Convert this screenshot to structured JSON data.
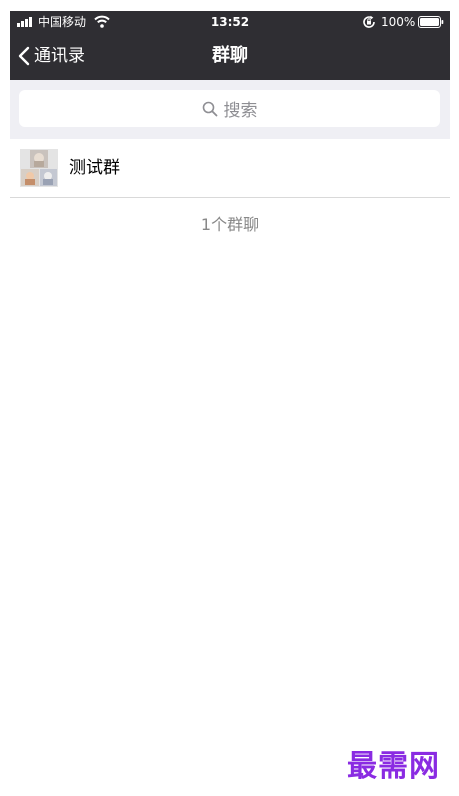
{
  "status_bar": {
    "carrier": "中国移动",
    "time": "13:52",
    "battery_percent": "100%",
    "battery_level": 1.0,
    "icons": [
      "signal-icon",
      "wifi-icon",
      "rotation-lock-icon",
      "battery-icon"
    ]
  },
  "nav_bar": {
    "back_label": "通讯录",
    "back_icon": "chevron-left-icon",
    "title": "群聊"
  },
  "search": {
    "placeholder": "搜索",
    "icon": "search-icon"
  },
  "groups": [
    {
      "name": "测试群",
      "avatar": "group-avatar-collage"
    }
  ],
  "group_count_text": "1个群聊",
  "watermark": "最需网",
  "colors": {
    "nav_background": "#2f2e33",
    "search_area_background": "#efeff4",
    "watermark": "#8a2be2",
    "secondary_text": "#888888"
  }
}
